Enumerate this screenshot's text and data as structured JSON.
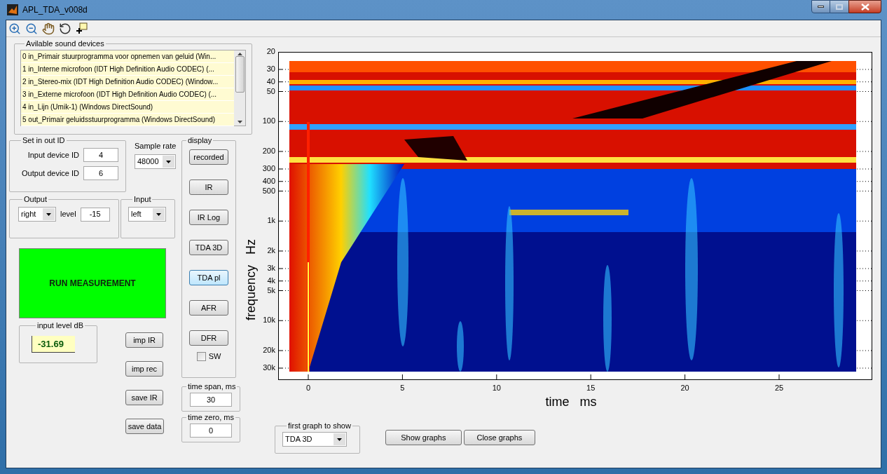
{
  "window": {
    "title": "APL_TDA_v008d"
  },
  "devices": {
    "label": "Avilable sound devices",
    "items": [
      "0 in_Primair stuurprogramma voor opnemen van geluid (Win...",
      "1 in_Interne microfoon (IDT High Definition Audio CODEC) (...",
      "2 in_Stereo-mix (IDT High Definition Audio CODEC) (Window...",
      "3 in_Externe microfoon (IDT High Definition Audio CODEC) (...",
      "4 in_Lijn (Umik-1) (Windows DirectSound)",
      "5 out_Primair geluidsstuurprogramma (Windows DirectSound)"
    ]
  },
  "set_ids": {
    "label": "Set in out ID",
    "fields": [
      {
        "label": "Input device ID",
        "value": "4"
      },
      {
        "label": "Output device ID",
        "value": "6"
      }
    ]
  },
  "sample_rate": {
    "label": "Sample rate",
    "value": "48000"
  },
  "output": {
    "label": "Output",
    "channel": "right",
    "level_label": "level",
    "level_value": "-15"
  },
  "input": {
    "label": "Input",
    "channel": "left"
  },
  "run_button": "RUN MEASUREMENT",
  "input_level": {
    "label": "input level dB",
    "value": "-31.69"
  },
  "file_buttons": [
    "imp IR",
    "imp rec",
    "save IR",
    "save data"
  ],
  "display": {
    "label": "display",
    "buttons": [
      {
        "label": "recorded",
        "selected": false
      },
      {
        "label": "IR",
        "selected": false
      },
      {
        "label": "IR Log",
        "selected": false
      },
      {
        "label": "TDA 3D",
        "selected": false
      },
      {
        "label": "TDA pl",
        "selected": true
      },
      {
        "label": "AFR",
        "selected": false
      },
      {
        "label": "DFR",
        "selected": false
      }
    ],
    "sw": {
      "label": "SW",
      "checked": false
    }
  },
  "time_span": {
    "label": "time span, ms",
    "value": "30"
  },
  "time_zero": {
    "label": "time zero, ms",
    "value": "0"
  },
  "plot": {
    "xlabel": "time   ms",
    "ylabel": "frequency   Hz",
    "xticks": [
      "0",
      "5",
      "10",
      "15",
      "20",
      "25"
    ],
    "yticks": [
      "20",
      "30",
      "40",
      "50",
      "100",
      "200",
      "300",
      "400",
      "500",
      "1k",
      "2k",
      "3k",
      "4k",
      "5k",
      "10k",
      "20k",
      "30k"
    ]
  },
  "first_graph": {
    "label": "first graph to show",
    "value": "TDA 3D"
  },
  "graph_buttons": [
    "Show graphs",
    "Close graphs"
  ]
}
